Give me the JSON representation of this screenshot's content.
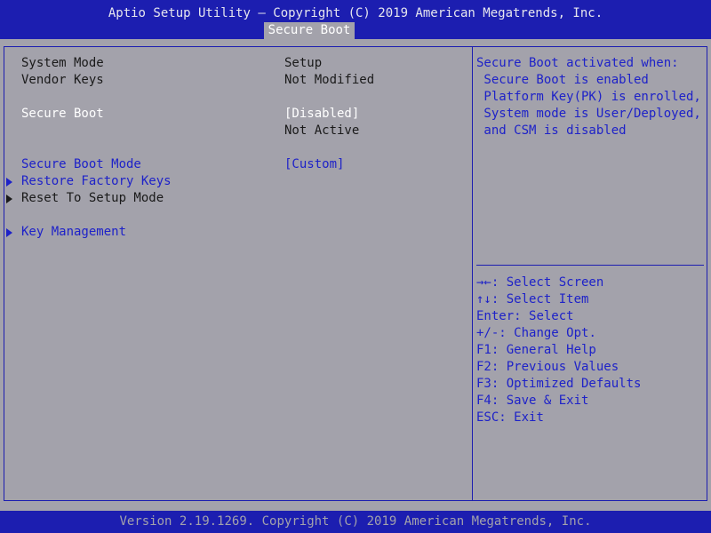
{
  "header": {
    "title": "Aptio Setup Utility – Copyright (C) 2019 American Megatrends, Inc.",
    "active_tab": "Secure Boot"
  },
  "settings": {
    "system_mode": {
      "label": "System Mode",
      "value": "Setup"
    },
    "vendor_keys": {
      "label": "Vendor Keys",
      "value": "Not Modified"
    },
    "secure_boot": {
      "label": "Secure Boot",
      "value": "[Disabled]",
      "status": "Not Active"
    },
    "secure_boot_mode": {
      "label": "Secure Boot Mode",
      "value": "[Custom]"
    },
    "restore_factory_keys": {
      "label": "Restore Factory Keys"
    },
    "reset_to_setup_mode": {
      "label": "Reset To Setup Mode"
    },
    "key_management": {
      "label": "Key Management"
    }
  },
  "help_panel": {
    "lines": [
      "Secure Boot activated when:",
      " Secure Boot is enabled",
      " Platform Key(PK) is enrolled,",
      " System mode is User/Deployed,",
      " and CSM is disabled"
    ]
  },
  "key_legend": [
    {
      "key": "→←",
      "action": ": Select Screen"
    },
    {
      "key": "↑↓",
      "action": ": Select Item"
    },
    {
      "key": "Enter",
      "action": ": Select"
    },
    {
      "key": "+/-",
      "action": ": Change Opt."
    },
    {
      "key": "F1",
      "action": ": General Help"
    },
    {
      "key": "F2",
      "action": ": Previous Values"
    },
    {
      "key": "F3",
      "action": ": Optimized Defaults"
    },
    {
      "key": "F4",
      "action": ": Save & Exit"
    },
    {
      "key": "ESC",
      "action": ": Exit"
    }
  ],
  "footer": {
    "text": "Version 2.19.1269. Copyright (C) 2019 American Megatrends, Inc."
  },
  "colors": {
    "bar_blue": "#1c1eb0",
    "panel_gray": "#a3a2ab",
    "highlight_text": "#1e22c8"
  }
}
